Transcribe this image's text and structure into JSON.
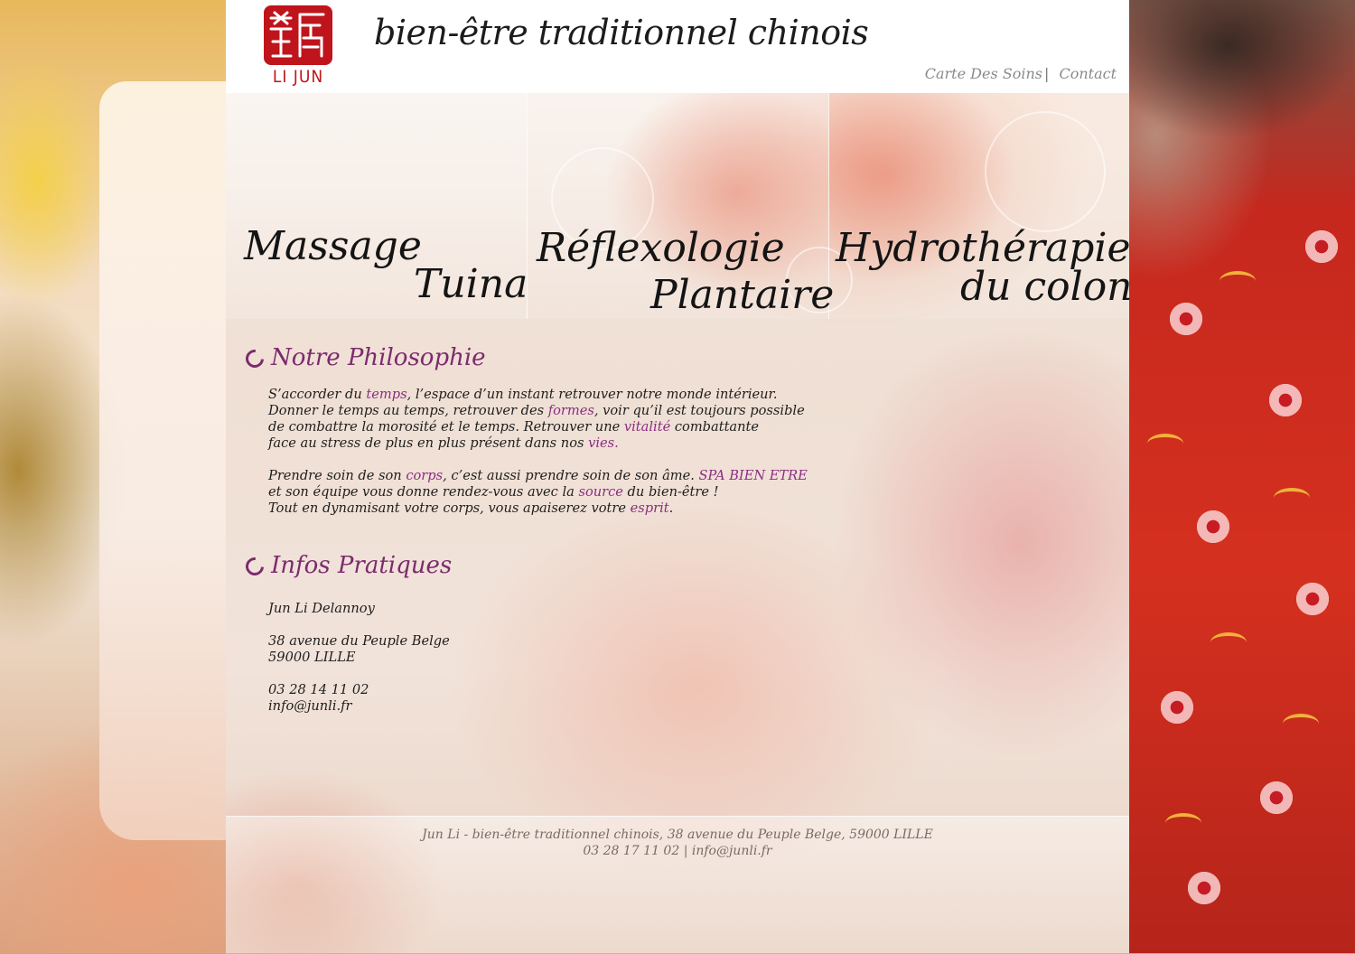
{
  "brand": {
    "logo_text": "LI JUN",
    "tagline": "bien-être traditionnel chinois",
    "accent_color": "#c0141c"
  },
  "nav": {
    "items": [
      "Carte Des Soins",
      "Contact"
    ],
    "separator": "|"
  },
  "tiles": [
    {
      "line1": "Massage",
      "line2": "Tuina"
    },
    {
      "line1": "Réflexologie",
      "line2": "Plantaire"
    },
    {
      "line1": "Hydrothérapie",
      "line2": "du colon"
    }
  ],
  "philosophy": {
    "heading": "Notre Philosophie",
    "l1a": "S’accorder du ",
    "l1b": "temps",
    "l1c": ",  l’espace d’un instant retrouver notre monde intérieur.",
    "l2a": "Donner le temps au temps, retrouver des ",
    "l2b": "formes",
    "l2c": ", voir qu’il est toujours possible",
    "l3a": "de combattre la morosité et le temps. Retrouver une ",
    "l3b": "vitalité",
    "l3c": " combattante",
    "l4a": "face au stress de plus en plus présent dans nos ",
    "l4b": "vies.",
    "l5a": "Prendre soin de son ",
    "l5b": "corps",
    "l5c": ", c’est aussi prendre soin de son âme. ",
    "l5d": "SPA BIEN ETRE",
    "l6a": "et son équipe vous donne rendez-vous avec la ",
    "l6b": "source",
    "l6c": " du bien-être !",
    "l7a": "Tout en dynamisant votre corps, vous apaiserez votre ",
    "l7b": "esprit",
    "l7c": "."
  },
  "infos": {
    "heading": "Infos Pratiques",
    "name": "Jun Li Delannoy",
    "street": "38 avenue du Peuple Belge",
    "city": "59000 LILLE",
    "phone": "03 28 14 11 02",
    "email": "info@junli.fr"
  },
  "footer": {
    "line1": "Jun Li - bien-être traditionnel chinois,  38 avenue du Peuple Belge, 59000 LILLE",
    "line2": "03 28 17 11 02 | info@junli.fr"
  },
  "colors": {
    "link": "#8b2d82",
    "heading": "#7d2a6e",
    "nav": "#8a8a8a"
  }
}
